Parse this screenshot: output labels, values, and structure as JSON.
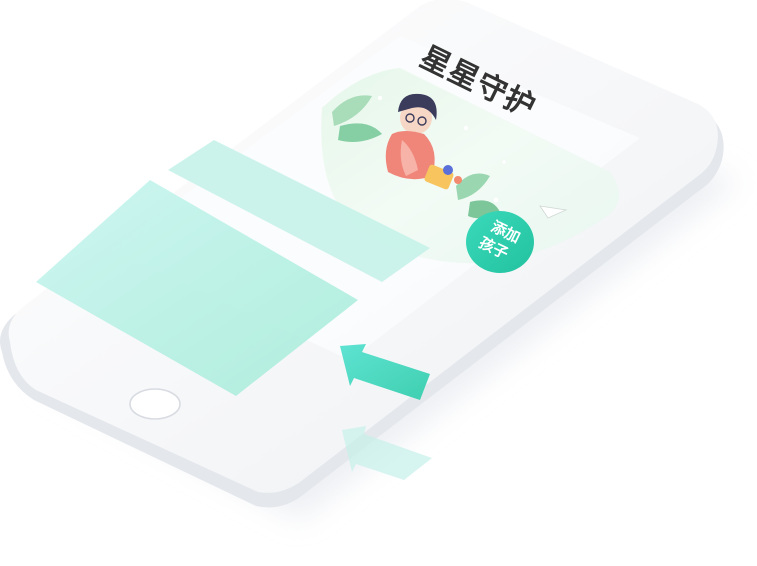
{
  "app": {
    "title": "星星守护"
  },
  "cta": {
    "line1": "添加",
    "line2": "孩子"
  },
  "colors": {
    "accent": "#2fcfae",
    "phone_body": "#f6f7f9",
    "phone_edge": "#e3e6eb",
    "card": "#9fead9",
    "card_light": "#bff3ec",
    "arrow": "#4fd9c3"
  },
  "icons": {
    "hero": "woman-illustration",
    "home_button": "home-button",
    "arrow": "arrow-icon",
    "paper_plane": "paper-plane-icon"
  }
}
